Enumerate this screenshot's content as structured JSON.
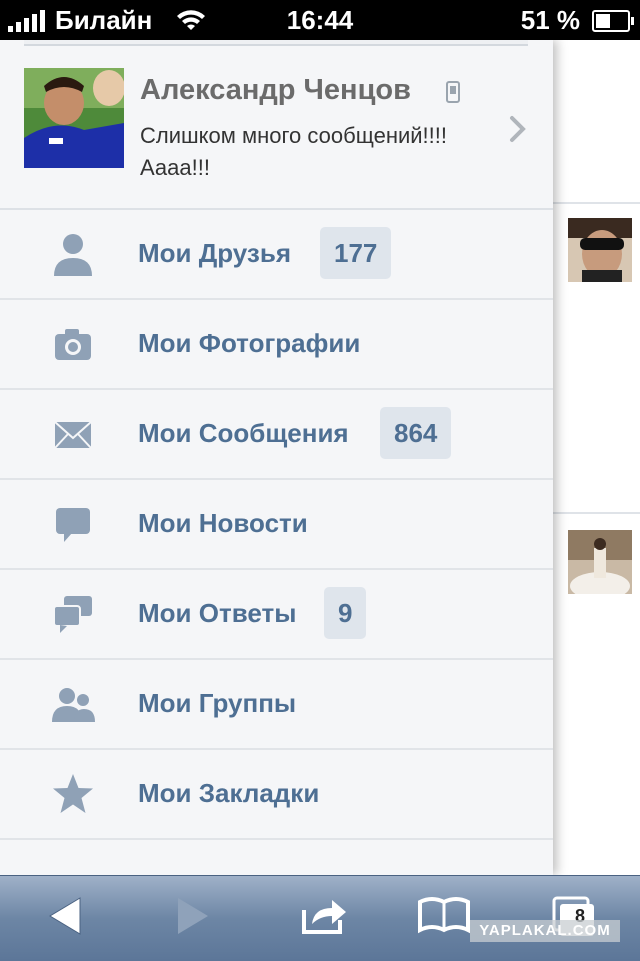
{
  "status_bar": {
    "carrier": "Билайн",
    "time": "16:44",
    "battery": "51 %"
  },
  "profile": {
    "name": "Александр Ченцов",
    "status": "Слишком много сообщений!!!!Аааа!!!"
  },
  "menu": {
    "items": [
      {
        "label": "Мои Друзья",
        "badge": "177",
        "icon": "person-icon"
      },
      {
        "label": "Мои Фотографии",
        "badge": "",
        "icon": "camera-icon"
      },
      {
        "label": "Мои Сообщения",
        "badge": "864",
        "icon": "envelope-icon"
      },
      {
        "label": "Мои Новости",
        "badge": "",
        "icon": "speech-bubble-icon"
      },
      {
        "label": "Мои Ответы",
        "badge": "9",
        "icon": "double-speech-bubble-icon"
      },
      {
        "label": "Мои Группы",
        "badge": "",
        "icon": "group-icon"
      },
      {
        "label": "Мои Закладки",
        "badge": "",
        "icon": "star-icon"
      }
    ]
  },
  "toolbar": {
    "tab_count": "8"
  },
  "watermark": "YAPLAKAL.COM",
  "colors": {
    "link": "#4e6f93",
    "badge_bg": "#dfe5ec",
    "toolbar": "#6d86a5"
  }
}
